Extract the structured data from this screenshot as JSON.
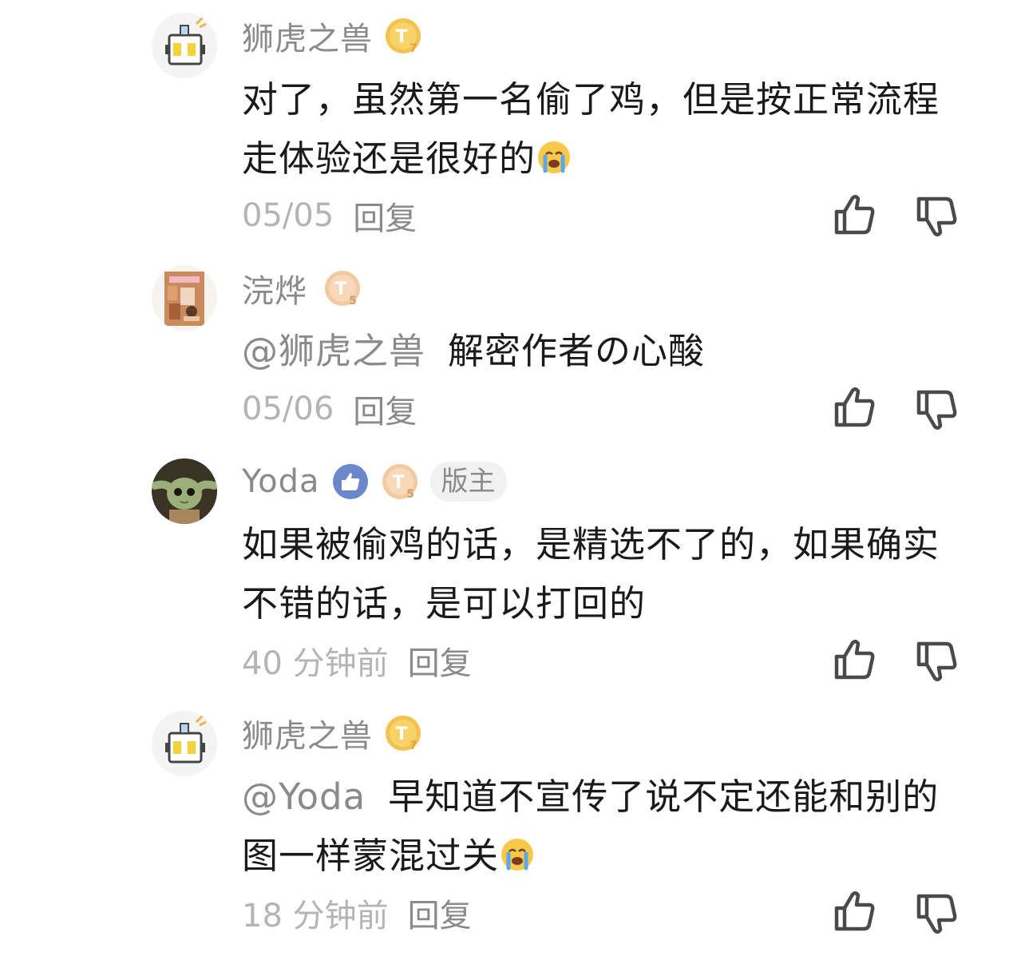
{
  "comments": [
    {
      "username": "狮虎之兽",
      "level": "7",
      "text": "对了，虽然第一名偷了鸡，但是按正常流程走体验还是很好的",
      "emoji": "crying-face",
      "time": "05/05",
      "reply_label": "回复"
    },
    {
      "username": "浣烨",
      "level": "5",
      "mention": "@狮虎之兽",
      "text": "解密作者の心酸",
      "time": "05/06",
      "reply_label": "回复"
    },
    {
      "username": "Yoda",
      "level": "5",
      "role": "版主",
      "text": "如果被偷鸡的话，是精选不了的，如果确实不错的话，是可以打回的",
      "time": "40 分钟前",
      "reply_label": "回复"
    },
    {
      "username": "狮虎之兽",
      "level": "7",
      "mention": "@Yoda",
      "text": "早知道不宣传了说不定还能和别的图一样蒙混过关",
      "emoji": "crying-face",
      "time": "18 分钟前",
      "reply_label": "回复"
    }
  ],
  "colors": {
    "username": "#8a8a8a",
    "body": "#1a1a1a",
    "time": "#b4b4b4",
    "badge_gold": "#f3c24f",
    "badge_peach": "#f2c9a0",
    "like_badge": "#6b86c9",
    "icon": "#4a4a4a"
  }
}
